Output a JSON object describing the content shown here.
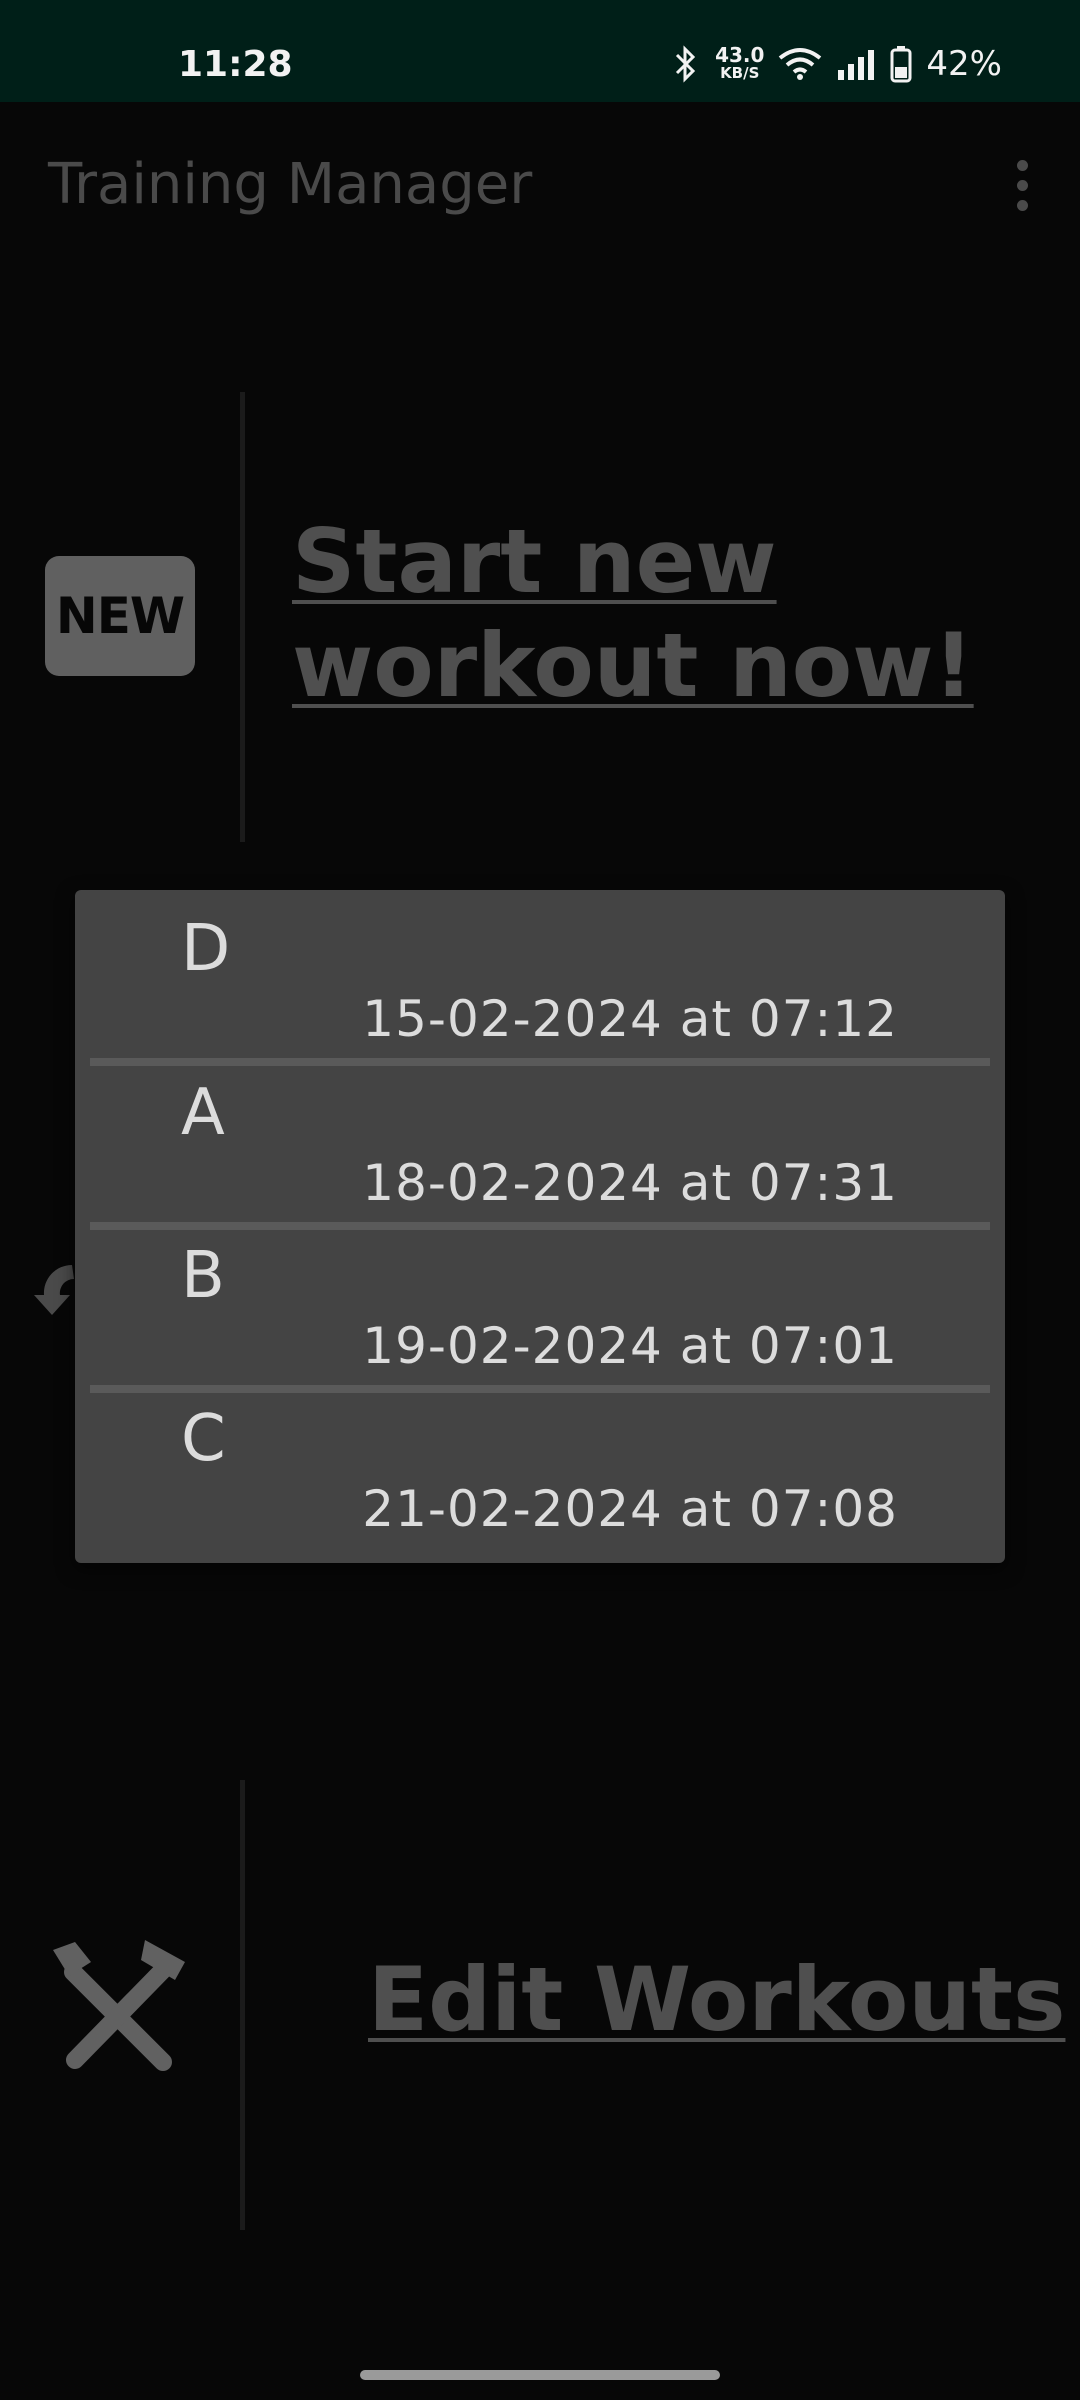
{
  "status_bar": {
    "time": "11:28",
    "net_speed_value": "43.0",
    "net_speed_unit": "KB/S",
    "battery_percent": "42%"
  },
  "app_bar": {
    "title": "Training Manager",
    "menu_icon": "overflow-menu-icon"
  },
  "start_section": {
    "badge_text": "NEW",
    "link_text": "Start new workout now!"
  },
  "edit_section": {
    "icon": "tools-icon",
    "link_text": "Edit Workouts"
  },
  "workout_popup": {
    "items": [
      {
        "name": "D",
        "date": "15-02-2024 at 07:12"
      },
      {
        "name": "A",
        "date": "18-02-2024 at 07:31"
      },
      {
        "name": "B",
        "date": "19-02-2024 at 07:01"
      },
      {
        "name": "C",
        "date": "21-02-2024 at 07:08"
      }
    ]
  },
  "colors": {
    "status_bar_bg": "#001f18",
    "background": "#070707",
    "popup_bg": "#444444",
    "muted_text": "#4f4f4f"
  }
}
